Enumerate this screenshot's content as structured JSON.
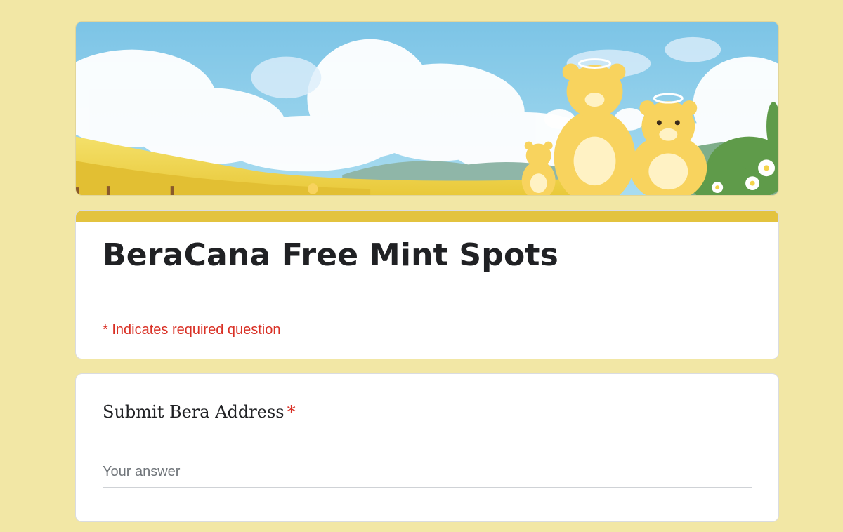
{
  "form": {
    "title": "BeraCana Free Mint Spots",
    "required_note": "* Indicates required question"
  },
  "question": {
    "label": "Submit Bera Address",
    "required_mark": "*",
    "placeholder": "Your answer",
    "value": ""
  },
  "theme": {
    "background": "#f2e7a5",
    "accent": "#e3c33f",
    "required_color": "#d93025"
  },
  "banner": {
    "description_icon": "bear-illustration"
  }
}
